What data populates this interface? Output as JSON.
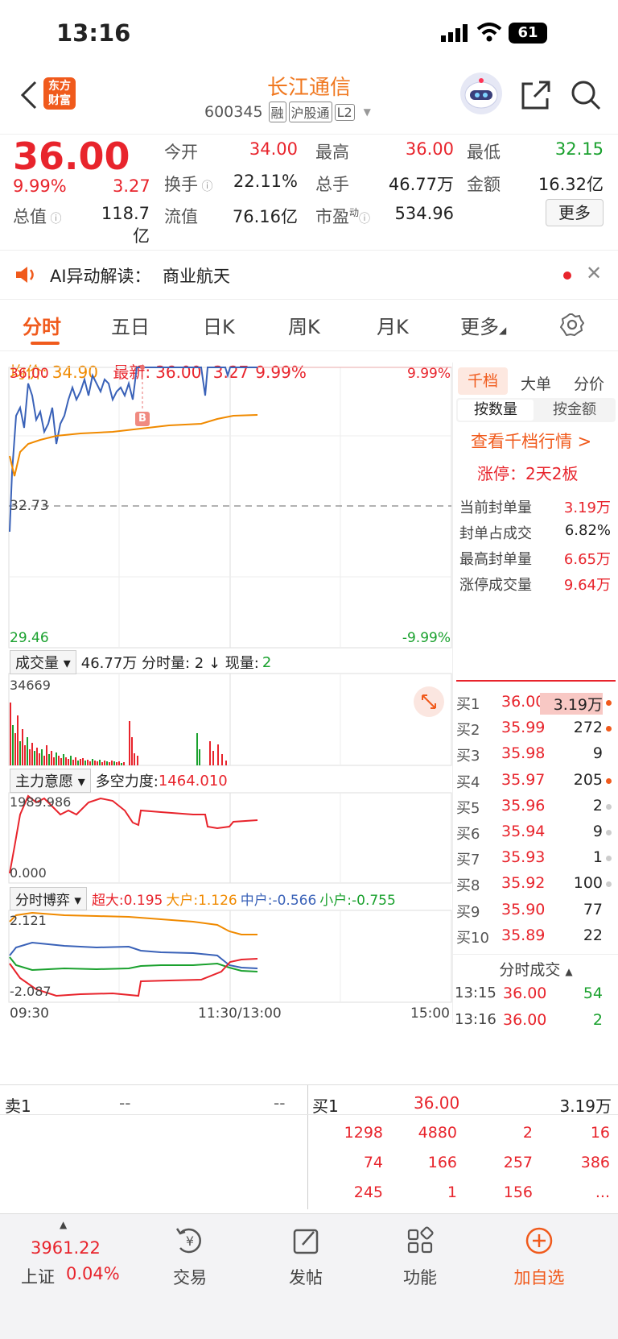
{
  "status": {
    "time": "13:16",
    "battery": "61"
  },
  "header": {
    "back": "<",
    "logo_line1": "东方",
    "logo_line2": "财富",
    "title": "长江通信",
    "code": "600345",
    "tag1": "融",
    "tag2": "沪股通",
    "tag3": "L2"
  },
  "quote": {
    "price": "36.00",
    "pct": "9.99%",
    "chg": "3.27",
    "labels": {
      "open": "今开",
      "high": "最高",
      "low": "最低",
      "turnover": "换手",
      "vol": "总手",
      "amount": "金额",
      "mktcap": "总值",
      "float": "流值",
      "pe": "市盈",
      "pe_sup": "动",
      "more": "更多"
    },
    "values": {
      "open": "34.00",
      "high": "36.00",
      "low": "32.15",
      "turnover": "22.11%",
      "vol": "46.77万",
      "amount": "16.32亿",
      "mktcap": "118.7亿",
      "float": "76.16亿",
      "pe": "534.96"
    }
  },
  "ai": {
    "label": "AI异动解读：",
    "text": "商业航天"
  },
  "tabs": [
    "分时",
    "五日",
    "日K",
    "周K",
    "月K",
    "更多"
  ],
  "chart": {
    "avg_label": "均价:",
    "avg": "34.90",
    "last_label": "最新:",
    "last": "36.00",
    "last_chg": "3.27",
    "last_pct": "9.99%",
    "top_price": "36.00",
    "top_pct": "9.99%",
    "mid_price": "32.73",
    "bot_price": "29.46",
    "bot_pct": "-9.99%",
    "buy_marker": "B",
    "vol_selector": "成交量",
    "vol_info": "46.77万 分时量: 2 ↓ 现量:",
    "vol_now": "2",
    "vol_max": "34669",
    "main_selector": "主力意愿",
    "main_info_label": "多空力度:",
    "main_info_val": "1464.010",
    "main_max": "1989.986",
    "main_min": "0.000",
    "game_selector": "分时博弈",
    "g1": "超大:0.195",
    "g2": "大户:1.126",
    "g3": "中户:-0.566",
    "g4": "小户:-0.755",
    "game_max": "2.121",
    "game_min": "-2.087",
    "t_start": "09:30",
    "t_mid": "11:30/13:00",
    "t_end": "15:00"
  },
  "right": {
    "tabs": [
      "千档",
      "大单",
      "分价"
    ],
    "subtabs": [
      "按数量",
      "按金额"
    ],
    "link": "查看千档行情 >",
    "limit": "涨停：2天2板",
    "rows": [
      {
        "label": "当前封单量",
        "val": "3.19万"
      },
      {
        "label": "封单占成交",
        "val": "6.82%"
      },
      {
        "label": "最高封单量",
        "val": "6.65万"
      },
      {
        "label": "涨停成交量",
        "val": "9.64万"
      }
    ],
    "bids": [
      {
        "l": "买1",
        "p": "36.00",
        "v": "3.19万"
      },
      {
        "l": "买2",
        "p": "35.99",
        "v": "272"
      },
      {
        "l": "买3",
        "p": "35.98",
        "v": "9"
      },
      {
        "l": "买4",
        "p": "35.97",
        "v": "205"
      },
      {
        "l": "买5",
        "p": "35.96",
        "v": "2"
      },
      {
        "l": "买6",
        "p": "35.94",
        "v": "9"
      },
      {
        "l": "买7",
        "p": "35.93",
        "v": "1"
      },
      {
        "l": "买8",
        "p": "35.92",
        "v": "100"
      },
      {
        "l": "买9",
        "p": "35.90",
        "v": "77"
      },
      {
        "l": "买10",
        "p": "35.89",
        "v": "22"
      }
    ],
    "trades_title": "分时成交",
    "trades": [
      {
        "t": "13:15",
        "p": "36.00",
        "v": "54"
      },
      {
        "t": "13:16",
        "p": "36.00",
        "v": "2"
      }
    ]
  },
  "orderbook": {
    "sell_label": "卖1",
    "sell_p": "--",
    "sell_v": "--",
    "buy_label": "买1",
    "buy_p": "36.00",
    "buy_v": "3.19万",
    "grid": [
      [
        "1298",
        "4880",
        "2",
        "16"
      ],
      [
        "74",
        "166",
        "257",
        "386"
      ],
      [
        "245",
        "1",
        "156",
        "..."
      ]
    ]
  },
  "bottom": {
    "index_val": "3961.22",
    "index_name": "上证",
    "index_pct": "0.04%",
    "trade": "交易",
    "post": "发帖",
    "func": "功能",
    "add": "加自选"
  }
}
